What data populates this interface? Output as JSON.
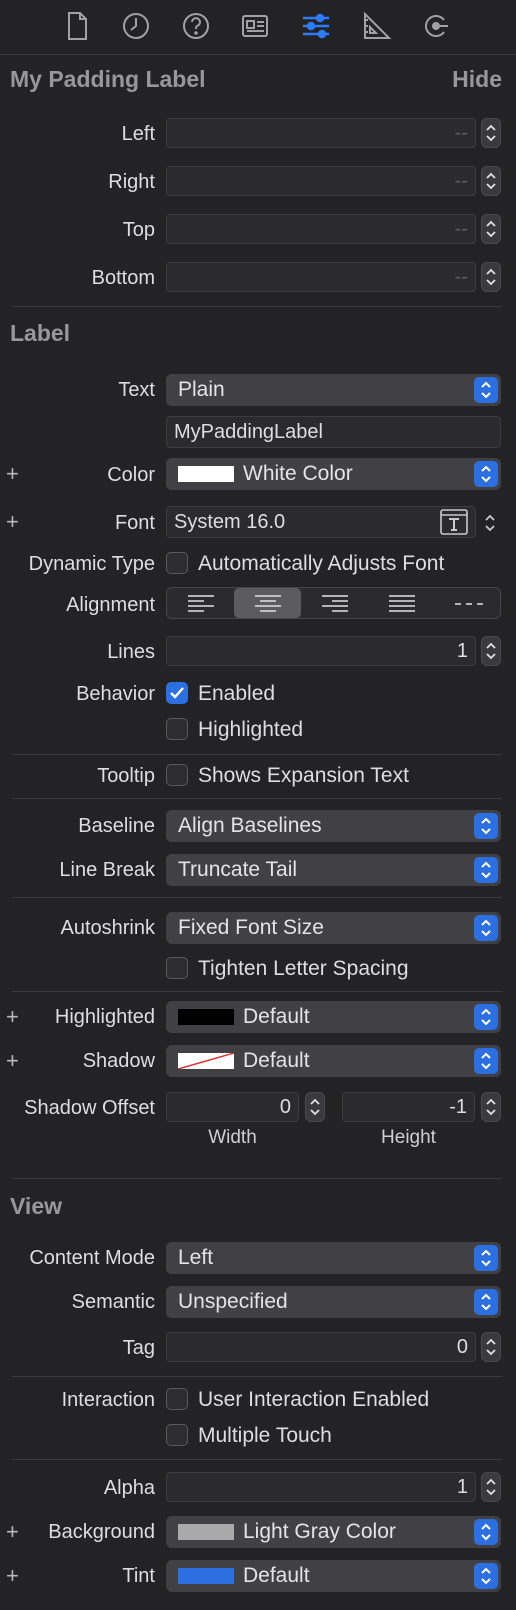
{
  "toolbar": {
    "icons": [
      "file-icon",
      "clock-icon",
      "help-icon",
      "identity-card-icon",
      "sliders-icon",
      "ruler-icon",
      "arrow-circle-icon"
    ],
    "active_icon": "sliders-icon",
    "accent": "#2c7cf6"
  },
  "padding_section": {
    "title": "My Padding Label",
    "hide": "Hide",
    "fields": [
      {
        "label": "Left",
        "value": "--"
      },
      {
        "label": "Right",
        "value": "--"
      },
      {
        "label": "Top",
        "value": "--"
      },
      {
        "label": "Bottom",
        "value": "--"
      }
    ]
  },
  "label_section": {
    "title": "Label",
    "text_label": "Text",
    "text_value": "Plain",
    "text_content": "MyPaddingLabel",
    "color_label": "Color",
    "color_value": "White Color",
    "color_swatch": "#ffffff",
    "font_label": "Font",
    "font_value": "System 16.0",
    "dynamic_type_label": "Dynamic Type",
    "dynamic_type_option": "Automatically Adjusts Font",
    "alignment_label": "Alignment",
    "alignment_options": [
      "left",
      "center",
      "right",
      "justified",
      "natural"
    ],
    "alignment_selected": "center",
    "lines_label": "Lines",
    "lines_value": "1",
    "behavior_label": "Behavior",
    "behavior_enabled": "Enabled",
    "behavior_highlighted": "Highlighted",
    "tooltip_label": "Tooltip",
    "tooltip_option": "Shows Expansion Text",
    "baseline_label": "Baseline",
    "baseline_value": "Align Baselines",
    "line_break_label": "Line Break",
    "line_break_value": "Truncate Tail",
    "autoshrink_label": "Autoshrink",
    "autoshrink_value": "Fixed Font Size",
    "tighten_option": "Tighten Letter Spacing",
    "highlighted_label": "Highlighted",
    "highlighted_value": "Default",
    "highlighted_swatch": "#000000",
    "shadow_label": "Shadow",
    "shadow_value": "Default",
    "shadow_offset_label": "Shadow Offset",
    "shadow_width": "0",
    "shadow_height": "-1",
    "width_label": "Width",
    "height_label": "Height"
  },
  "view_section": {
    "title": "View",
    "content_mode_label": "Content Mode",
    "content_mode_value": "Left",
    "semantic_label": "Semantic",
    "semantic_value": "Unspecified",
    "tag_label": "Tag",
    "tag_value": "0",
    "interaction_label": "Interaction",
    "user_interaction": "User Interaction Enabled",
    "multiple_touch": "Multiple Touch",
    "alpha_label": "Alpha",
    "alpha_value": "1",
    "background_label": "Background",
    "background_value": "Light Gray Color",
    "background_swatch": "#a9a9a9",
    "tint_label": "Tint",
    "tint_value": "Default",
    "tint_swatch": "#2c6fe0"
  },
  "plus": "+"
}
